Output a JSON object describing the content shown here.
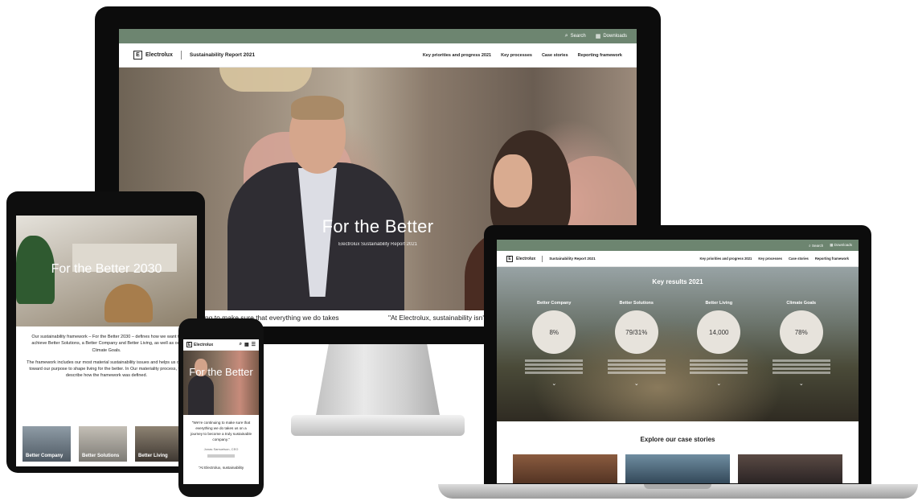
{
  "desktop": {
    "topbar": {
      "search_label": "Search",
      "downloads_label": "Downloads",
      "search_icon": "search-icon",
      "downloads_icon": "grid-icon"
    },
    "nav": {
      "brand": "Electrolux",
      "report": "Sustainability Report 2021",
      "links": [
        "Key priorities and progress 2021",
        "Key processes",
        "Case stories",
        "Reporting framework"
      ]
    },
    "hero": {
      "title": "For the Better",
      "subtitle": "Electrolux Sustainability Report 2021",
      "quote_left": "ing to make sure that everything we do takes",
      "quote_right": "\"At Electrolux, sustainability isn't on"
    }
  },
  "tablet": {
    "hero_title": "For the Better 2030",
    "para1": "Our sustainability framework – For the Better 2030 – defines how we want to achieve Better Solutions, a Better Company and Better Living, as well as our Climate Goals.",
    "para2": "The framework includes our most material sustainability issues and helps us drive toward our purpose to shape living for the better. In Our materiality process, we describe how the framework was defined.",
    "cards": [
      "Better Company",
      "Better Solutions",
      "Better Living"
    ]
  },
  "phone": {
    "brand": "Electrolux",
    "hero_title": "For the Better",
    "quote": "\"We're continuing to make sure that everything we do takes us on a journey to become a truly sustainable company.\"",
    "attribution": "Jonas Samuelson, CEO",
    "more": "\"At Electrolux, sustainability"
  },
  "laptop": {
    "topbar": {
      "search_label": "Search",
      "downloads_label": "Downloads"
    },
    "nav": {
      "brand": "Electrolux",
      "report": "Sustainability Report 2021",
      "links": [
        "Key priorities and progress 2021",
        "Key processes",
        "Case stories",
        "Reporting framework"
      ]
    },
    "hero": {
      "title": "Key results 2021",
      "stats": [
        {
          "label": "Better Company",
          "value": "8%"
        },
        {
          "label": "Better Solutions",
          "value": "79/31%"
        },
        {
          "label": "Better Living",
          "value": "14,000"
        },
        {
          "label": "Climate Goals",
          "value": "78%"
        }
      ]
    },
    "explore_title": "Explore our case stories"
  },
  "colors": {
    "brand_green": "#6d8570",
    "device_black": "#0c0c0c"
  }
}
